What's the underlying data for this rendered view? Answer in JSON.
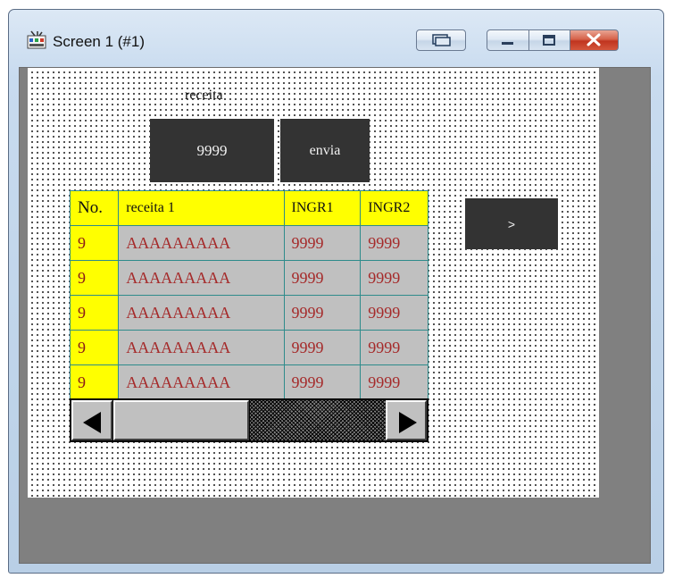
{
  "window": {
    "title": "Screen 1 (#1)",
    "buttons": [
      "restore-layout",
      "minimize",
      "maximize",
      "close"
    ],
    "close_color": "#c8402a"
  },
  "form": {
    "label": "receita",
    "value_button": "9999",
    "send_button": "envia",
    "next_button": ">"
  },
  "grid": {
    "headers": [
      "No.",
      "receita 1",
      "INGR1",
      "INGR2"
    ],
    "rows": [
      [
        "9",
        "AAAAAAAAA",
        "9999",
        "9999"
      ],
      [
        "9",
        "AAAAAAAAA",
        "9999",
        "9999"
      ],
      [
        "9",
        "AAAAAAAAA",
        "9999",
        "9999"
      ],
      [
        "9",
        "AAAAAAAAA",
        "9999",
        "9999"
      ],
      [
        "9",
        "AAAAAAAAA",
        "9999",
        "9999"
      ]
    ],
    "header_color": "#ffff00",
    "cell_color": "#c0c0c0",
    "text_color": "#a52a2a",
    "scroll_position": 0.35
  }
}
